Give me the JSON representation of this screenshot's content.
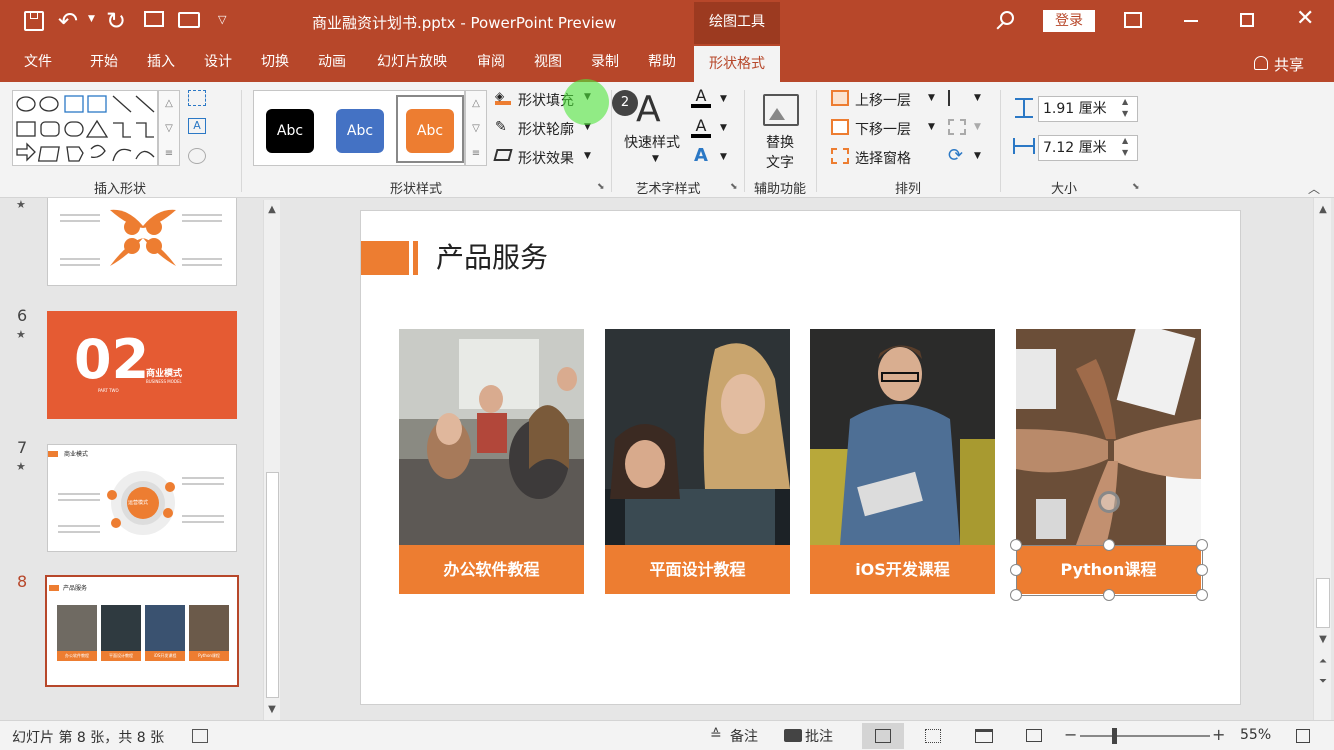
{
  "titlebar": {
    "title": "商业融资计划书.pptx - PowerPoint Preview",
    "context_tab": "绘图工具",
    "login": "登录"
  },
  "tabs": [
    "文件",
    "开始",
    "插入",
    "设计",
    "切换",
    "动画",
    "幻灯片放映",
    "审阅",
    "视图",
    "录制",
    "帮助",
    "形状格式"
  ],
  "share": "共享",
  "ribbon": {
    "insert_shape": {
      "label": "插入形状"
    },
    "shape_styles": {
      "label": "形状样式",
      "samples": [
        "Abc",
        "Abc",
        "Abc"
      ],
      "fill": "形状填充",
      "outline": "形状轮廓",
      "effects": "形状效果",
      "badge": "2"
    },
    "wordart": {
      "quick_styles": "快速样式",
      "label": "艺术字样式"
    },
    "accessibility": {
      "alt_text_line1": "替换",
      "alt_text_line2": "文字",
      "label": "辅助功能"
    },
    "arrange": {
      "bring_forward": "上移一层",
      "send_backward": "下移一层",
      "selection_pane": "选择窗格",
      "label": "排列"
    },
    "size": {
      "height": "1.91 厘米",
      "width": "7.12 厘米",
      "label": "大小"
    }
  },
  "thumbnails": [
    {
      "num": "6",
      "main": "02",
      "title": "商业模式",
      "sub": "BUSINESS MODEL",
      "part": "PART TWO"
    },
    {
      "num": "7",
      "title": "商业模式",
      "center": "运营模式"
    },
    {
      "num": "8",
      "title": "产品服务",
      "labels": [
        "办公软件教程",
        "平面设计教程",
        "iOS开发课程",
        "Python课程"
      ]
    }
  ],
  "slide": {
    "title": "产品服务",
    "cards": [
      "办公软件教程",
      "平面设计教程",
      "iOS开发课程",
      "Python课程"
    ]
  },
  "statusbar": {
    "slide_info": "幻灯片 第 8 张，共 8 张",
    "notes": "备注",
    "comments": "批注",
    "zoom": "55%"
  },
  "colors": {
    "accent": "#b7472a",
    "orange": "#ed7d31",
    "blue": "#4472c4"
  }
}
